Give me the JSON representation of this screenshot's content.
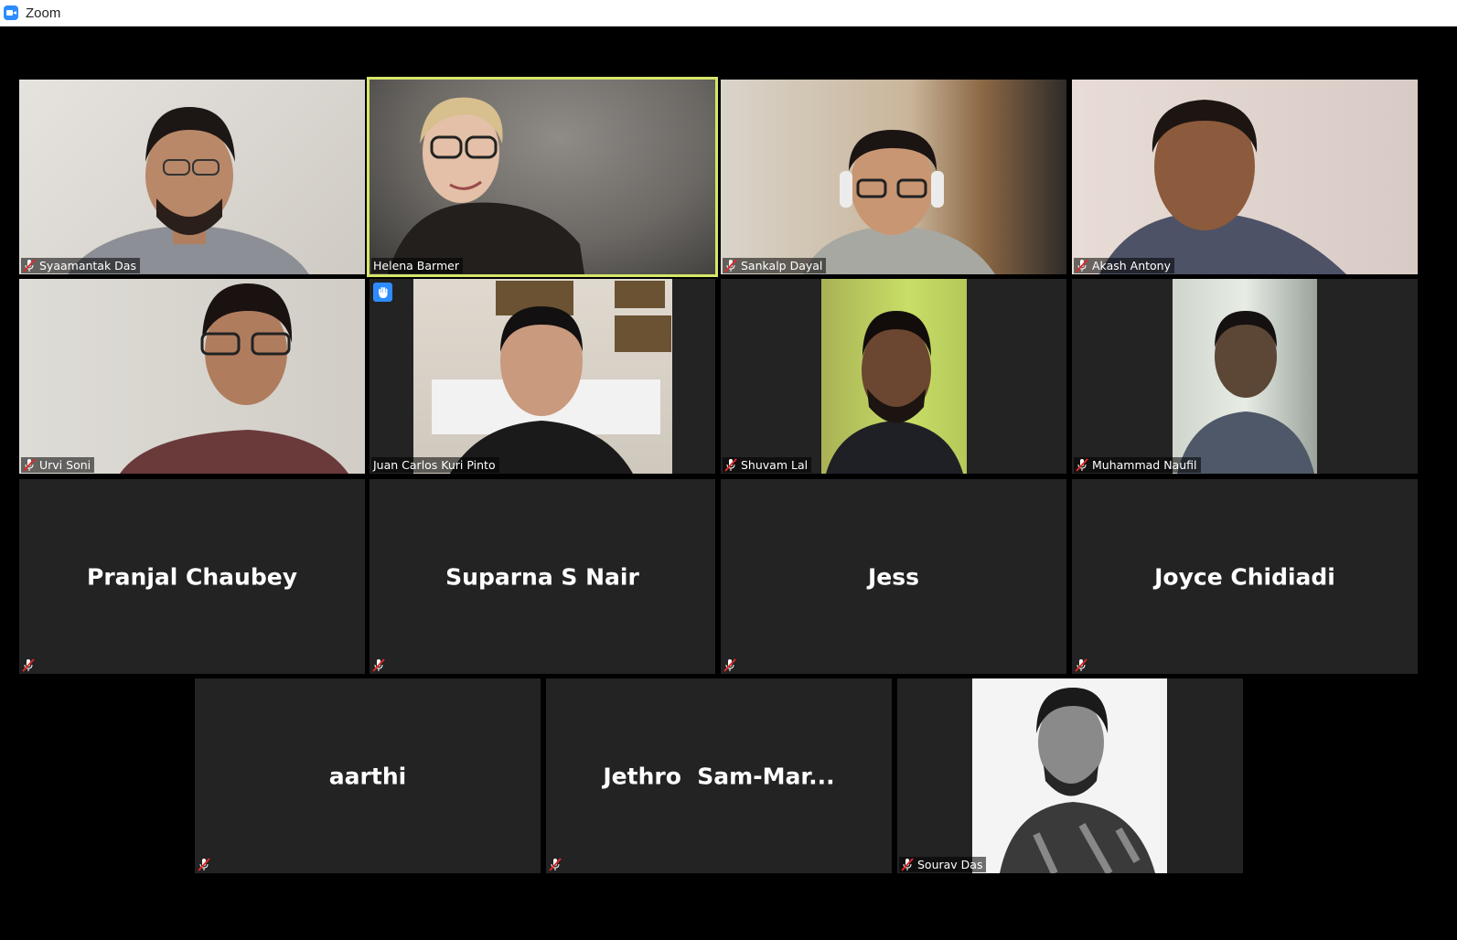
{
  "window": {
    "title": "Zoom",
    "app_icon": "zoom-camera-icon",
    "accent": "#2d8cff"
  },
  "participants": [
    {
      "name": "Syaamantak Das",
      "muted": true,
      "video": true,
      "active_speaker": false
    },
    {
      "name": "Helena Barmer",
      "muted": false,
      "video": true,
      "active_speaker": true,
      "highlight_color": "#d6e66a"
    },
    {
      "name": "Sankalp Dayal",
      "muted": true,
      "video": true,
      "active_speaker": false
    },
    {
      "name": "Akash Antony",
      "muted": true,
      "video": true,
      "active_speaker": false
    },
    {
      "name": "Urvi Soni",
      "muted": true,
      "video": true,
      "active_speaker": false
    },
    {
      "name": "Juan Carlos Kuri Pinto",
      "muted": false,
      "video": true,
      "hand_raised": true,
      "active_speaker": false
    },
    {
      "name": "Shuvam Lal",
      "muted": true,
      "video": true,
      "active_speaker": false
    },
    {
      "name": "Muhammad Naufil",
      "muted": true,
      "video": true,
      "active_speaker": false
    },
    {
      "name": "Pranjal Chaubey",
      "muted": true,
      "video": false
    },
    {
      "name": "Suparna S Nair",
      "muted": true,
      "video": false
    },
    {
      "name": "Jess",
      "muted": true,
      "video": false
    },
    {
      "name": "Joyce Chidiadi",
      "muted": true,
      "video": false
    },
    {
      "name": "aarthi",
      "muted": true,
      "video": false
    },
    {
      "name": "Jethro  Sam-Mar...",
      "muted": true,
      "video": false
    },
    {
      "name": "Sourav Das",
      "muted": true,
      "video": true,
      "profile_photo": true
    }
  ],
  "icons": {
    "muted": "mic-off-icon",
    "raised_hand": "raised-hand-icon"
  }
}
